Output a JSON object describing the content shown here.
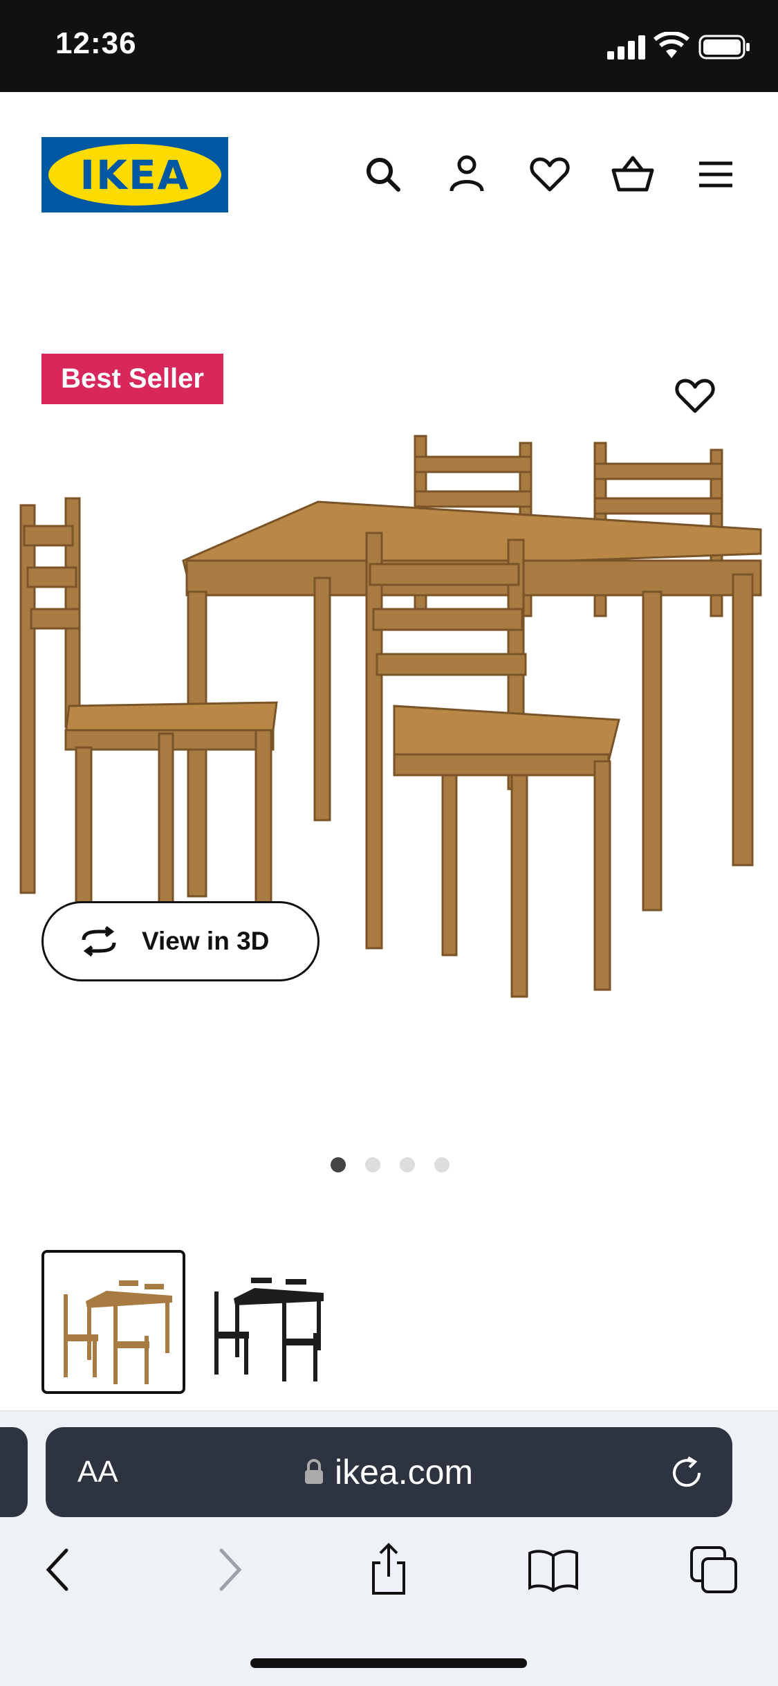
{
  "status_bar": {
    "time": "12:36"
  },
  "header": {
    "logo_text": "IKEA",
    "icons": [
      "search-icon",
      "account-icon",
      "heart-icon",
      "basket-icon",
      "menu-icon"
    ]
  },
  "product": {
    "badge": "Best Seller",
    "view_3d_label": "View in 3D",
    "carousel": {
      "total": 4,
      "active": 1
    },
    "thumbnails": [
      "antique stain",
      "black-brown"
    ]
  },
  "browser": {
    "aa_label": "AA",
    "url": "ikea.com"
  },
  "colors": {
    "ikea_blue": "#0058a3",
    "ikea_yellow": "#ffdb00",
    "badge_red": "#d7275b",
    "wood": "#a87b43"
  }
}
